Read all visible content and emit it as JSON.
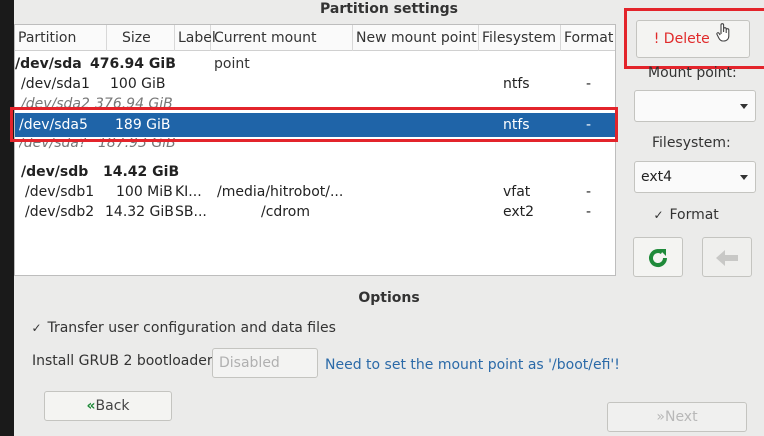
{
  "window": {
    "title": "Partition settings"
  },
  "table": {
    "columns": [
      "Partition",
      "Size",
      "Label",
      "Current mount point",
      "New mount point",
      "Filesystem",
      "Format"
    ],
    "rows": [
      {
        "partition": "/dev/sda",
        "size": "476.94 GiB",
        "label": "",
        "current_mount": "",
        "new_mount": "",
        "filesystem": "",
        "format": ""
      },
      {
        "partition": "/dev/sda1",
        "size": "100 GiB",
        "label": "",
        "current_mount": "",
        "new_mount": "",
        "filesystem": "ntfs",
        "format": "-"
      },
      {
        "partition": "/dev/sda2",
        "size": "376.94 GiB",
        "label": "",
        "current_mount": "",
        "new_mount": "",
        "filesystem": "",
        "format": ""
      },
      {
        "partition": "/dev/sda5",
        "size": "189 GiB",
        "label": "",
        "current_mount": "",
        "new_mount": "",
        "filesystem": "ntfs",
        "format": "-"
      },
      {
        "partition": "/dev/sda?",
        "size": "187.93 GiB",
        "label": "",
        "current_mount": "",
        "new_mount": "",
        "filesystem": "",
        "format": ""
      },
      {
        "partition": "/dev/sdb",
        "size": "14.42 GiB",
        "label": "",
        "current_mount": "",
        "new_mount": "",
        "filesystem": "",
        "format": ""
      },
      {
        "partition": "/dev/sdb1",
        "size": "100 MiB",
        "label": "KI...",
        "current_mount": "/media/hitrobot/...",
        "new_mount": "",
        "filesystem": "vfat",
        "format": "-"
      },
      {
        "partition": "/dev/sdb2",
        "size": "14.32 GiB",
        "label": "SB...",
        "current_mount": "/cdrom",
        "new_mount": "",
        "filesystem": "ext2",
        "format": "-"
      }
    ]
  },
  "side": {
    "delete_label": "! Delete",
    "mount_point_label": "Mount point:",
    "mount_point_value": "",
    "filesystem_label": "Filesystem:",
    "filesystem_value": "ext4",
    "format_label": "Format",
    "format_checked": "✓"
  },
  "options": {
    "title": "Options",
    "transfer_check": "✓",
    "transfer_label": "Transfer user configuration and data files",
    "grub_label": "Install GRUB 2 bootloader:",
    "grub_value": "Disabled",
    "grub_hint": "Need to set the mount point as '/boot/efi'!"
  },
  "nav": {
    "back_label": "Back",
    "next_label": "Next"
  },
  "colors": {
    "selection": "#1f64a8",
    "highlight": "#e3242b",
    "delete_text": "#e02a2a",
    "refresh_icon": "#1f8a3a"
  }
}
